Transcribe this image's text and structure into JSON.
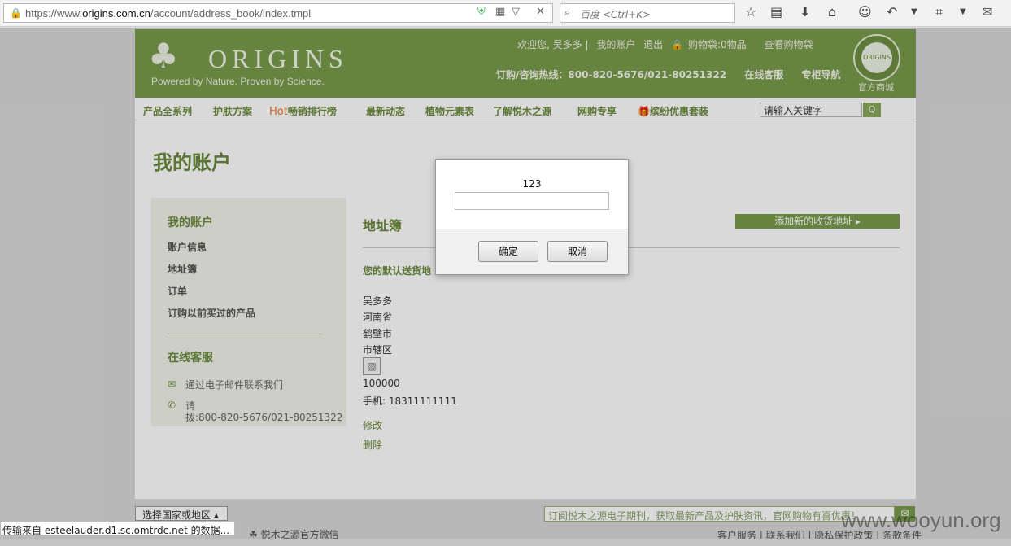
{
  "browser": {
    "url_prefix": "https://www.",
    "url_domain": "origins.com.cn",
    "url_path": "/account/address_book/index.tmpl",
    "search_placeholder": "百度 <Ctrl+K>"
  },
  "header": {
    "logo": "ORIGINS",
    "tagline": "Powered by Nature. Proven by Science.",
    "welcome": "欢迎您, 吴多多 |",
    "my_account": "我的账户",
    "logout": "退出",
    "cart": "购物袋:0物品",
    "view_cart": "查看购物袋",
    "hotline": "订购/咨询热线：800-820-5676/021-80251322",
    "online_service": "在线客服",
    "store_nav": "专柜导航",
    "badge_text": "ORIGINS",
    "badge_label": "官方商城"
  },
  "nav": {
    "items": [
      "产品全系列",
      "护肤方案",
      "畅销排行榜",
      "最新动态",
      "植物元素表",
      "了解悦木之源",
      "网购专享",
      "缤纷优惠套装"
    ],
    "hot_label": "Hot",
    "search_placeholder": "请输入关键字",
    "search_button": "Q"
  },
  "page_title": "我的账户",
  "sidebar": {
    "account_heading": "我的账户",
    "links": [
      "账户信息",
      "地址簿",
      "订单",
      "订购以前买过的产品"
    ],
    "service_heading": "在线客服",
    "email_contact": "通过电子邮件联系我们",
    "phone_label": "请",
    "phone_number": "拨:800-820-5676/021-80251322"
  },
  "main": {
    "heading": "地址簿",
    "add_button": "添加新的收货地址 ▸",
    "default_label": "您的默认送货地",
    "address": [
      "吴多多",
      "河南省",
      "鹤壁市",
      "市辖区"
    ],
    "postcode": "100000",
    "mobile": "手机: 18311111111",
    "edit": "修改",
    "delete": "删除"
  },
  "footer": {
    "region_select": "选择国家或地区 ▴",
    "subscribe_placeholder": "订阅悦木之源电子期刊，获取最新产品及护肤资讯，官网购物有喜优惠！",
    "subscribe_button": "✉",
    "wechat": "悦木之源官方微信",
    "links": "客户服务 | 联系我们 | 隐私保护政策 | 条款条件",
    "status_bar": "传输来自 esteelauder.d1.sc.omtrdc.net 的数据...",
    "watermark": "www.wooyun.org"
  },
  "dialog": {
    "message": "123",
    "input_value": "",
    "ok": "确定",
    "cancel": "取消"
  }
}
